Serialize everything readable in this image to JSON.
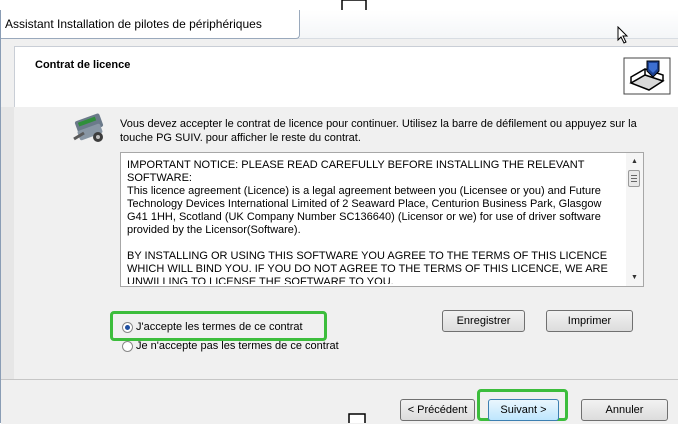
{
  "window": {
    "title": "Assistant Installation de pilotes de périphériques"
  },
  "header": {
    "title": "Contrat de licence",
    "icon": "installer-box-icon"
  },
  "body": {
    "instruction": "Vous devez accepter le contrat de licence pour continuer. Utilisez la barre de défilement ou appuyez sur la touche PG SUIV. pour afficher le reste du contrat.",
    "license_paragraphs": [
      "IMPORTANT NOTICE: PLEASE READ CAREFULLY BEFORE INSTALLING THE RELEVANT SOFTWARE:",
      "This licence agreement (Licence) is a legal agreement between you (Licensee or you) and Future Technology Devices International Limited of 2 Seaward Place, Centurion Business Park, Glasgow G41 1HH, Scotland (UK Company Number SC136640) (Licensor or we) for use of driver software provided by the Licensor(Software).",
      "BY INSTALLING OR USING THIS SOFTWARE YOU AGREE TO THE TERMS OF THIS LICENCE WHICH WILL BIND YOU.  IF YOU DO NOT AGREE TO THE TERMS OF THIS LICENCE, WE ARE UNWILLING TO LICENSE THE SOFTWARE TO YOU."
    ],
    "buttons": {
      "save": "Enregistrer",
      "print": "Imprimer"
    },
    "radios": {
      "accept": "J'accepte les termes de ce contrat",
      "decline": "Je n'accepte pas les termes de ce contrat",
      "selected": "accept"
    }
  },
  "footer": {
    "back": "< Précédent",
    "next": "Suivant >",
    "cancel": "Annuler"
  },
  "colors": {
    "highlight": "#3cbd3c",
    "next_button_border": "#3c7fb1"
  }
}
